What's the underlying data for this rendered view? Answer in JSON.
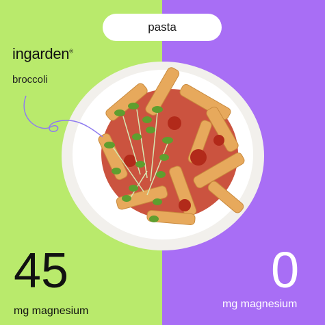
{
  "pill": {
    "label": "pasta"
  },
  "brand": {
    "name": "ingarden",
    "mark": "®"
  },
  "left": {
    "label": "broccoli",
    "value": "45",
    "unit": "mg magnesium",
    "color": "#b9ea6c"
  },
  "right": {
    "value": "0",
    "unit": "mg magnesium",
    "color": "#a86ef5"
  },
  "icons": {
    "plate": "plate-of-pasta-image",
    "sprout": "microgreens-illustration"
  }
}
